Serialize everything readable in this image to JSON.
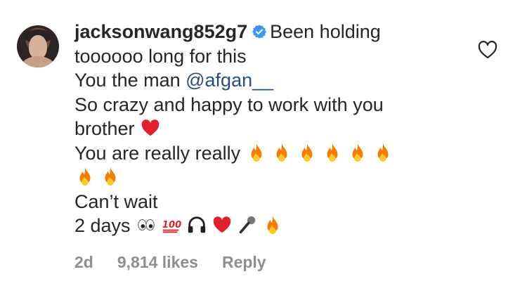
{
  "comment": {
    "username": "jacksonwang852g7",
    "first_line_text": "Been holding",
    "line2": "toooooo long for this",
    "line3_prefix": "You the man ",
    "mention": "@afgan__",
    "line4": "So crazy and happy to work with you",
    "line5": "brother",
    "line6": "You are really really",
    "line8": "Can’t wait",
    "line9": "2 days",
    "emojis": [
      "red-heart-icon",
      "fire-icon",
      "eyes-icon",
      "hundred-points-icon",
      "headphones-icon",
      "microphone-icon"
    ]
  },
  "meta": {
    "time": "2d",
    "likes": "9,814 likes",
    "reply": "Reply"
  },
  "colors": {
    "text": "#262626",
    "muted": "#8e8e8e",
    "mention": "#2a4b7c",
    "verified": "#3897f0"
  }
}
